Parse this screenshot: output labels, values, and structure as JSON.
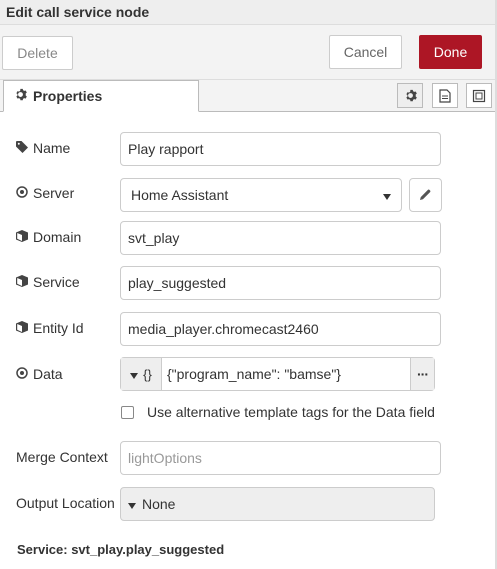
{
  "dialog": {
    "title": "Edit call service node"
  },
  "toolbar": {
    "delete_label": "Delete",
    "cancel_label": "Cancel",
    "done_label": "Done"
  },
  "tabs": {
    "properties_label": "Properties",
    "icons": [
      "gear-icon",
      "description-icon",
      "appearance-icon"
    ]
  },
  "form": {
    "name": {
      "label": "Name",
      "value": "Play rapport"
    },
    "server": {
      "label": "Server",
      "value": "Home Assistant"
    },
    "domain": {
      "label": "Domain",
      "value": "svt_play"
    },
    "service": {
      "label": "Service",
      "value": "play_suggested"
    },
    "entity_id": {
      "label": "Entity Id",
      "value": "media_player.chromecast2460"
    },
    "data": {
      "label": "Data",
      "type_label": "{}",
      "value": "{\"program_name\": \"bamse\"}",
      "expand_label": "···"
    },
    "alt_tags": {
      "label": "Use alternative template tags for the Data field",
      "checked": false
    },
    "merge_context": {
      "label": "Merge Context",
      "placeholder": "lightOptions"
    },
    "output_location": {
      "label": "Output Location",
      "value": "None"
    }
  },
  "footer": {
    "service_summary": "Service: svt_play.play_suggested"
  },
  "colors": {
    "done_bg": "#ad1625",
    "titlebar_bg": "#eeeeee"
  }
}
